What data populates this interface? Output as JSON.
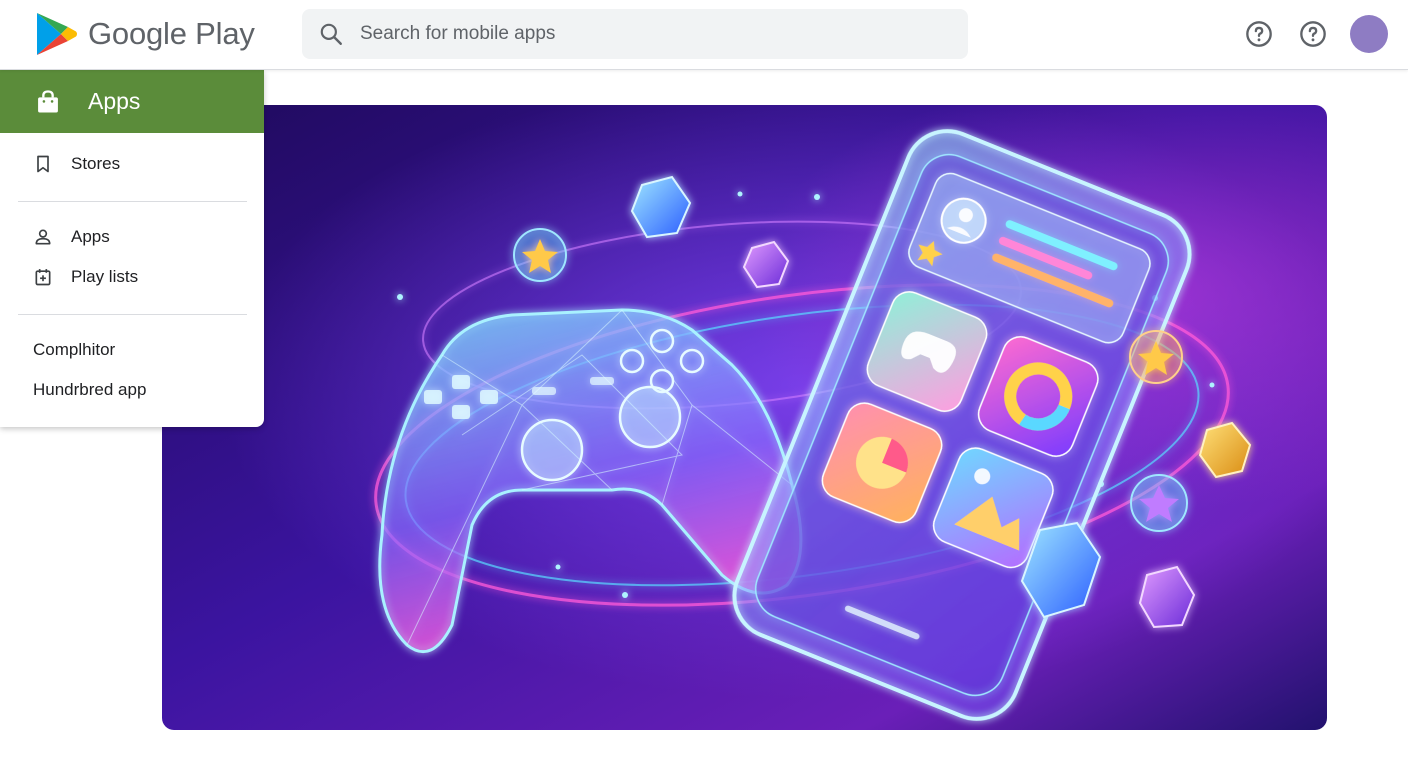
{
  "header": {
    "logo_text": "Google Play",
    "search_placeholder": "Search for mobile apps",
    "help_icon_1": "help-circle-icon",
    "help_icon_2": "help-circle-icon",
    "avatar_color": "#8e7cc3"
  },
  "drawer": {
    "active_item": {
      "label": "Apps",
      "icon": "shopping-bag-icon",
      "color": "#5b8c3a"
    },
    "items": [
      {
        "label": "Stores",
        "icon": "bookmark-icon"
      },
      {
        "label": "Apps",
        "icon": "person-icon"
      },
      {
        "label": "Play lists",
        "icon": "calendar-add-icon"
      },
      {
        "label": "Complhitor"
      },
      {
        "label": "Hundrbred app"
      }
    ]
  },
  "hero": {
    "image_subject": "Neon illustration of a glowing game controller and smartphone with floating gems and stars",
    "colors": {
      "bg_dark": "#2a0f6b",
      "bg_mid": "#5a1fb0",
      "glow_cyan": "#5ad8ff",
      "glow_pink": "#ff5ad8"
    }
  }
}
